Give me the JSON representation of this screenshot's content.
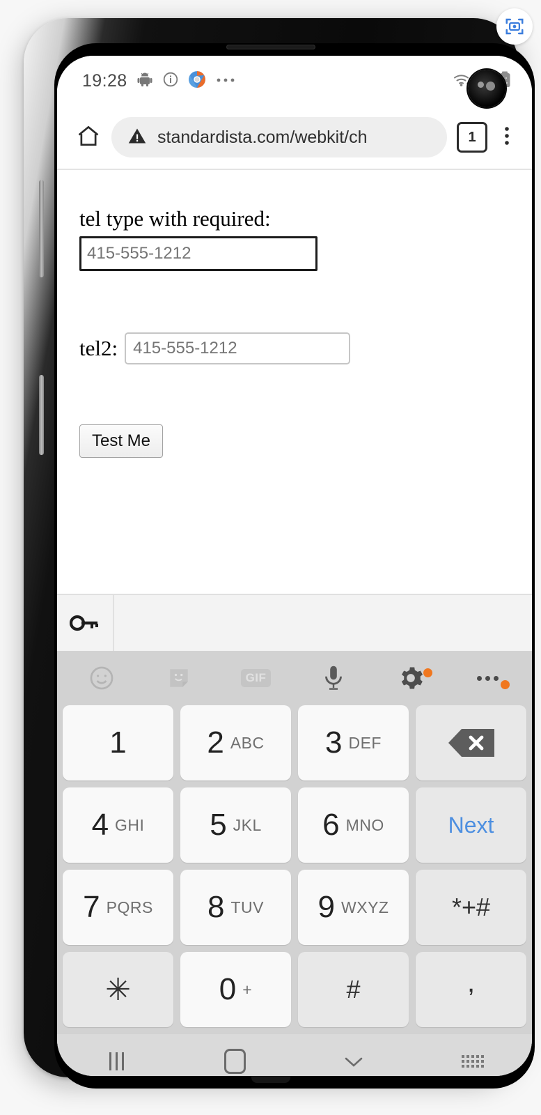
{
  "status_bar": {
    "clock": "19:28",
    "left_icons": [
      "android-robot-icon",
      "info-circle-icon",
      "chrome-icon",
      "more-notifications-icon"
    ],
    "right_icons": [
      "wifi-icon",
      "signal-bars-icon",
      "battery-icon"
    ]
  },
  "browser": {
    "home_icon": "home-icon",
    "security_icon": "warning-triangle-icon",
    "url": "standardista.com/webkit/ch",
    "tab_count": "1",
    "menu_icon": "overflow-menu-icon"
  },
  "page": {
    "tel1_label": "tel type with required:",
    "tel1_placeholder": "415-555-1212",
    "tel1_value": "",
    "tel2_label": "tel2:",
    "tel2_placeholder": "415-555-1212",
    "tel2_value": "",
    "submit_label": "Test Me"
  },
  "autofill": {
    "key_icon": "password-key-icon",
    "suggestion": ""
  },
  "keyboard": {
    "toolbar": [
      {
        "name": "emoji-icon",
        "badge": false,
        "dim": true
      },
      {
        "name": "sticker-icon",
        "badge": false,
        "dim": true
      },
      {
        "name": "gif-icon",
        "label": "GIF",
        "badge": false,
        "dim": true
      },
      {
        "name": "microphone-icon",
        "badge": false,
        "dim": false
      },
      {
        "name": "settings-gear-icon",
        "badge": true,
        "dim": false
      },
      {
        "name": "keyboard-more-icon",
        "badge": true,
        "dim": false
      }
    ],
    "rows": [
      [
        {
          "num": "1",
          "sub": "",
          "type": "num"
        },
        {
          "num": "2",
          "sub": "ABC",
          "type": "num"
        },
        {
          "num": "3",
          "sub": "DEF",
          "type": "num"
        },
        {
          "num": "",
          "sub": "",
          "type": "backspace",
          "name": "backspace-key"
        }
      ],
      [
        {
          "num": "4",
          "sub": "GHI",
          "type": "num"
        },
        {
          "num": "5",
          "sub": "JKL",
          "type": "num"
        },
        {
          "num": "6",
          "sub": "MNO",
          "type": "num"
        },
        {
          "num": "Next",
          "sub": "",
          "type": "next",
          "name": "next-key"
        }
      ],
      [
        {
          "num": "7",
          "sub": "PQRS",
          "type": "num"
        },
        {
          "num": "8",
          "sub": "TUV",
          "type": "num"
        },
        {
          "num": "9",
          "sub": "WXYZ",
          "type": "num"
        },
        {
          "num": "*+#",
          "sub": "",
          "type": "symbol",
          "name": "symbols-key"
        }
      ],
      [
        {
          "num": "✳",
          "sub": "",
          "type": "star",
          "name": "asterisk-key"
        },
        {
          "num": "0",
          "sub": "+",
          "type": "num"
        },
        {
          "num": "#",
          "sub": "",
          "type": "symbol",
          "name": "hash-key"
        },
        {
          "num": ",",
          "sub": "",
          "type": "comma",
          "name": "comma-key"
        }
      ]
    ],
    "next_label_color": "#4d8fe0",
    "badge_color": "#f0771f"
  },
  "nav_bar": {
    "recents_icon": "recents-icon",
    "home_icon": "home-nav-icon",
    "dismiss_icon": "chevron-down-icon",
    "switch_keyboard_icon": "keyboard-switch-icon"
  },
  "overlay": {
    "scan_badge_icon": "screenshot-scan-icon",
    "badge_color": "#3b7ddd"
  }
}
